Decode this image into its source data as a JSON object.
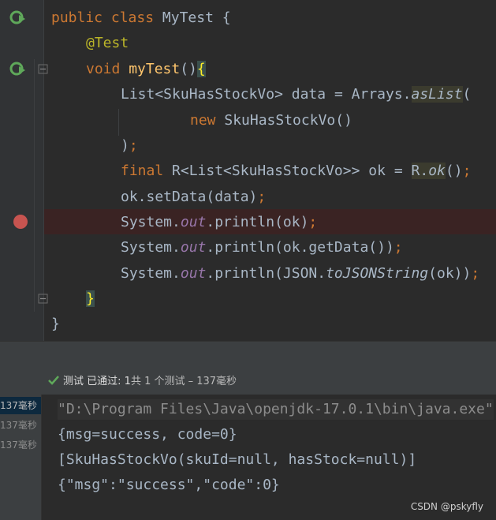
{
  "editor": {
    "code": {
      "l1": {
        "kw1": "public",
        "kw2": "class",
        "name": "MyTest",
        "brace": "{"
      },
      "l2": {
        "annotation": "@Test"
      },
      "l3": {
        "kw": "void",
        "fn": "myTest",
        "paren": "()",
        "brace": "{"
      },
      "l4": {
        "type": "List<SkuHasStockVo>",
        "var": "data",
        "eq": "=",
        "cls": "Arrays.",
        "method": "asList",
        "paren": "("
      },
      "l5": {
        "kw": "new",
        "ctor": "SkuHasStockVo()"
      },
      "l6": {
        "text": ")",
        "semi": ";"
      },
      "l7": {
        "kw": "final",
        "type": "R<List<SkuHasStockVo>>",
        "var": "ok",
        "eq": "=",
        "cls": "R.",
        "method": "ok",
        "paren": "()",
        "semi": ";"
      },
      "l8": {
        "text": "ok.setData(data)",
        "semi": ";"
      },
      "l9": {
        "sys": "System.",
        "out": "out",
        "call": ".println(ok)",
        "semi": ";"
      },
      "l10": {
        "sys": "System.",
        "out": "out",
        "call": ".println(ok.getData())",
        "semi": ";"
      },
      "l11": {
        "sys": "System.",
        "out": "out",
        "call1": ".println(JSON.",
        "method": "toJSONString",
        "call2": "(ok))",
        "semi": ";"
      },
      "l12": {
        "brace": "}"
      },
      "l13": {
        "brace": "}"
      }
    }
  },
  "test_bar": {
    "status_label": "测试 已通过:",
    "passed_count": "1",
    "total_text": "共 1 个测试 – 137毫秒"
  },
  "console": {
    "tree_items": [
      "137毫秒",
      "137毫秒",
      "137毫秒"
    ],
    "lines": [
      "\"D:\\Program Files\\Java\\openjdk-17.0.1\\bin\\java.exe\"",
      "{msg=success, code=0}",
      "[SkuHasStockVo(skuId=null, hasStock=null)]",
      "{\"msg\":\"success\",\"code\":0}"
    ]
  },
  "watermark": "CSDN @pskyfly",
  "colors": {
    "background": "#2b2b2b",
    "keyword": "#cc7832",
    "annotation": "#bbb529",
    "function": "#ffc66d",
    "static_field": "#9876aa",
    "breakpoint": "#c75450",
    "passed_check": "#5fa85a"
  },
  "icons": [
    "run-test-icon",
    "breakpoint-icon",
    "fold-icon",
    "check-icon"
  ]
}
